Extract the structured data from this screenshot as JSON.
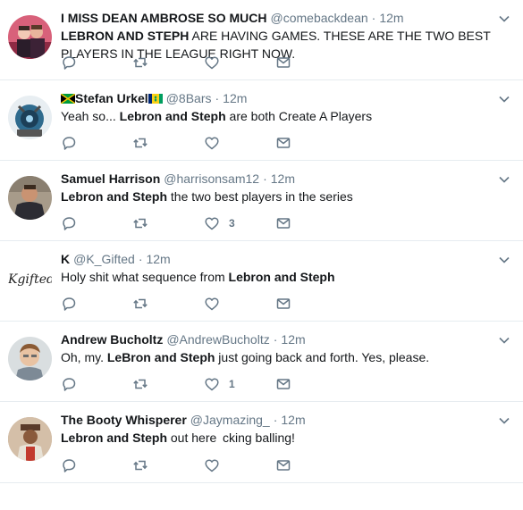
{
  "colors": {
    "icon": "#657786",
    "text": "#14171a",
    "muted": "#657786",
    "divider": "#e6ecf0"
  },
  "icons": [
    "reply-icon",
    "retweet-icon",
    "like-icon",
    "dm-icon",
    "chevron-down-icon"
  ],
  "tweets": [
    {
      "name": "I MISS DEAN AMBROSE SO MUCH",
      "handle": "@comebackdean",
      "time": "12m",
      "text_parts": [
        {
          "t": "LEBRON AND STEPH",
          "b": true
        },
        {
          "t": " ARE HAVING GAMES. THESE ARE THE TWO BEST PLAYERS IN THE LEAGUE RIGHT NOW.",
          "b": false
        }
      ],
      "likes": ""
    },
    {
      "name": "Stefan Urkel",
      "handle": "@8Bars",
      "time": "12m",
      "text_parts": [
        {
          "t": "Yeah so... ",
          "b": false
        },
        {
          "t": "Lebron and Steph",
          "b": true
        },
        {
          "t": " are both Create A Players",
          "b": false
        }
      ],
      "likes": ""
    },
    {
      "name": "Samuel Harrison",
      "handle": "@harrisonsam12",
      "time": "12m",
      "text_parts": [
        {
          "t": "Lebron and Steph",
          "b": true
        },
        {
          "t": " the two best players in the series",
          "b": false
        }
      ],
      "likes": "3"
    },
    {
      "name": "K",
      "handle": "@K_Gifted",
      "time": "12m",
      "avatar_text": "Kgifted",
      "text_parts": [
        {
          "t": "Holy shit what sequence from ",
          "b": false
        },
        {
          "t": "Lebron and Steph",
          "b": true
        }
      ],
      "likes": ""
    },
    {
      "name": "Andrew Bucholtz",
      "handle": "@AndrewBucholtz",
      "time": "12m",
      "text_parts": [
        {
          "t": "Oh, my. ",
          "b": false
        },
        {
          "t": "LeBron and Steph",
          "b": true
        },
        {
          "t": " just going back and forth. Yes, please.",
          "b": false
        }
      ],
      "likes": "1"
    },
    {
      "name": "The Booty Whisperer",
      "handle": "@Jaymazing_",
      "time": "12m",
      "text_parts": [
        {
          "t": "Lebron and Steph",
          "b": true
        },
        {
          "t": " out here ",
          "b": false
        },
        {
          "t": " ",
          "b": false
        },
        {
          "t": "cking balling!",
          "b": false
        }
      ],
      "likes": ""
    }
  ]
}
